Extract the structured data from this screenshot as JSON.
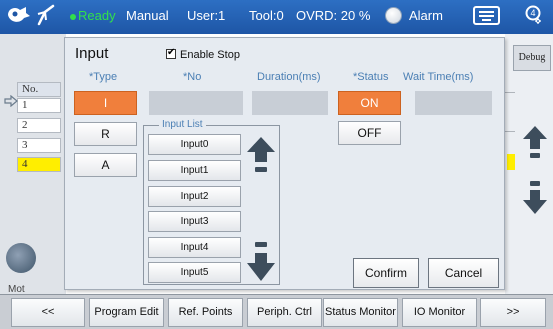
{
  "status_bar": {
    "ready": "Ready",
    "mode": "Manual",
    "user": "User:1",
    "tool": "Tool:0",
    "ovrd": "OVRD: 20 %",
    "alarm": "Alarm",
    "colors": {
      "bar": "#1e56a6",
      "ready": "#32e04a"
    }
  },
  "background": {
    "row_numbers": [
      "No.",
      "1",
      "2",
      "3",
      "4"
    ],
    "mot_label": "Mot",
    "debug_label": "Debug"
  },
  "dialog": {
    "title": "Input",
    "enable_stop_label": "Enable Stop",
    "enable_stop_checked": true,
    "columns": {
      "type": "*Type",
      "no": "*No",
      "duration": "Duration(ms)",
      "status": "*Status",
      "wait_time": "Wait Time(ms)"
    },
    "type_buttons": [
      "I",
      "R",
      "A"
    ],
    "type_selected": "I",
    "no_value": "",
    "duration_value": "",
    "wait_time_value": "",
    "status_buttons": [
      "ON",
      "OFF"
    ],
    "status_selected": "ON",
    "input_list_label": "Input List",
    "input_list": [
      "Input0",
      "Input1",
      "Input2",
      "Input3",
      "Input4",
      "Input5"
    ],
    "confirm_label": "Confirm",
    "cancel_label": "Cancel",
    "accent_color": "#f07f3c"
  },
  "bottom_menu": [
    "<<",
    "Program Edit",
    "Ref. Points",
    "Periph. Ctrl",
    "Status Monitor",
    "IO Monitor",
    ">>"
  ],
  "icons": [
    "logo-icon",
    "teach-icon",
    "alarm-lamp-icon",
    "keyboard-icon",
    "user-settings-icon",
    "pointer-icon",
    "up-arrow-icon",
    "down-arrow-icon"
  ]
}
